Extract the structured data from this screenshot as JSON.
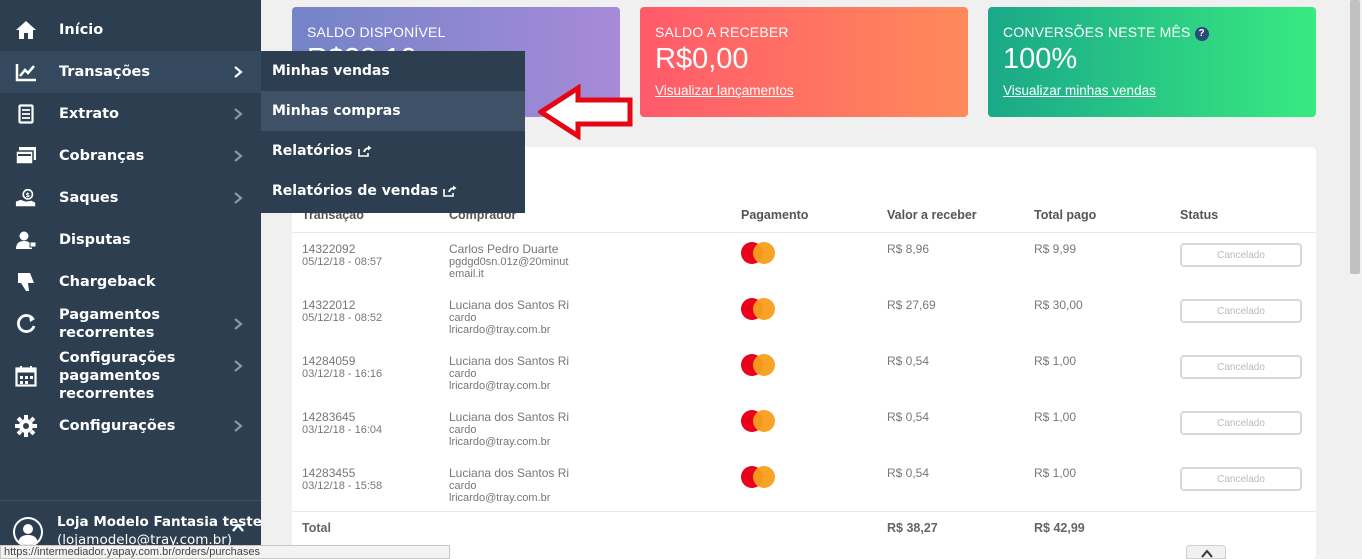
{
  "sidebar": {
    "items": [
      {
        "label": "Início",
        "icon": "home-icon"
      },
      {
        "label": "Transações",
        "icon": "chart-line-icon"
      },
      {
        "label": "Extrato",
        "icon": "document-icon"
      },
      {
        "label": "Cobranças",
        "icon": "invoice-icon"
      },
      {
        "label": "Saques",
        "icon": "hand-coin-icon"
      },
      {
        "label": "Disputas",
        "icon": "user-dispute-icon"
      },
      {
        "label": "Chargeback",
        "icon": "thumbs-down-icon"
      },
      {
        "label": "Pagamentos recorrentes",
        "icon": "refresh-icon"
      },
      {
        "label": "Configurações pagamentos recorrentes",
        "icon": "calendar-icon"
      },
      {
        "label": "Configurações",
        "icon": "gear-icon"
      }
    ],
    "user": {
      "name": "Loja Modelo Fantasia teste",
      "email": "(lojamodelo@tray.com.br)"
    }
  },
  "submenu": {
    "items": [
      {
        "label": "Minhas vendas"
      },
      {
        "label": "Minhas compras"
      },
      {
        "label": "Relatórios"
      },
      {
        "label": "Relatórios de vendas"
      }
    ]
  },
  "cards": {
    "available": {
      "title": "SALDO DISPONÍVEL",
      "value": "R$38,10"
    },
    "receivable": {
      "title": "SALDO A RECEBER",
      "value": "R$0,00",
      "link": "Visualizar lançamentos"
    },
    "conversions": {
      "title": "CONVERSÕES NESTE MÊS",
      "value": "100%",
      "link": "Visualizar minhas vendas",
      "help": "?"
    }
  },
  "table": {
    "headers": [
      "Transação",
      "Comprador",
      "Pagamento",
      "Valor a receber",
      "Total pago",
      "Status"
    ],
    "rows": [
      {
        "id": "14322092",
        "date": "05/12/18 - 08:57",
        "buyer1": "Carlos Pedro Duarte",
        "buyer2": "pgdgd0sn.01z@20minut",
        "buyer3": "email.it",
        "receive": "R$ 8,96",
        "paid": "R$ 9,99",
        "status": "Cancelado"
      },
      {
        "id": "14322012",
        "date": "05/12/18 - 08:52",
        "buyer1": "Luciana dos Santos Ri",
        "buyer2": "cardo",
        "buyer3": "lricardo@tray.com.br",
        "receive": "R$ 27,69",
        "paid": "R$ 30,00",
        "status": "Cancelado"
      },
      {
        "id": "14284059",
        "date": "03/12/18 - 16:16",
        "buyer1": "Luciana dos Santos Ri",
        "buyer2": "cardo",
        "buyer3": "lricardo@tray.com.br",
        "receive": "R$ 0,54",
        "paid": "R$ 1,00",
        "status": "Cancelado"
      },
      {
        "id": "14283645",
        "date": "03/12/18 - 16:04",
        "buyer1": "Luciana dos Santos Ri",
        "buyer2": "cardo",
        "buyer3": "lricardo@tray.com.br",
        "receive": "R$ 0,54",
        "paid": "R$ 1,00",
        "status": "Cancelado"
      },
      {
        "id": "14283455",
        "date": "03/12/18 - 15:58",
        "buyer1": "Luciana dos Santos Ri",
        "buyer2": "cardo",
        "buyer3": "lricardo@tray.com.br",
        "receive": "R$ 0,54",
        "paid": "R$ 1,00",
        "status": "Cancelado"
      }
    ],
    "total": {
      "label": "Total",
      "receive": "R$ 38,27",
      "paid": "R$ 42,99"
    }
  },
  "statusbar": {
    "url": "https://intermediador.yapay.com.br/orders/purchases"
  },
  "colors": {
    "sidebar": "#2c3e50",
    "arrow": "#e30613",
    "mastercard_red": "#eb001b",
    "mastercard_orange": "#f79e1b"
  }
}
